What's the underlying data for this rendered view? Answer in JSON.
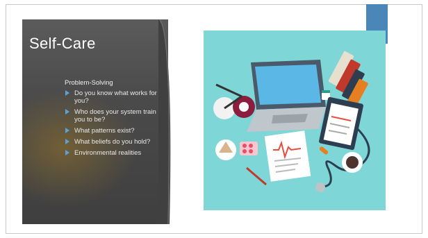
{
  "slide": {
    "title": "Self-Care",
    "subheading": "Problem-Solving",
    "bullets": [
      "Do you know what works for you?",
      "Who does your system train you to be?",
      "What patterns exist?",
      "What beliefs do you hold?",
      "Environmental realities"
    ]
  },
  "colors": {
    "panel": "#4a4a4a",
    "accent_bar": "#4a87b8",
    "bullet": "#5aa3d6",
    "illustration_bg": "#7fd6d6"
  },
  "illustration": {
    "subject": "desk-with-laptop-books-lamp-clipboard-stethoscope-coffee-pills"
  }
}
